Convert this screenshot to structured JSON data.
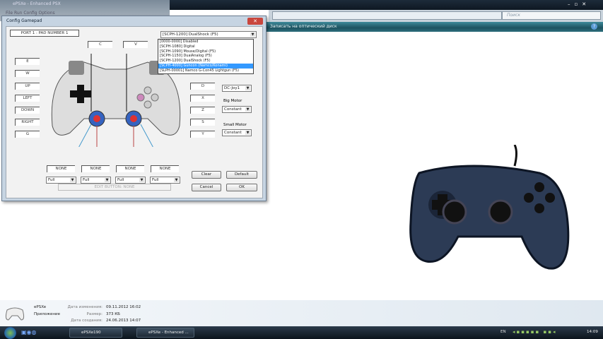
{
  "behind_window": {
    "title": "ePSXe - Enhanced PSX",
    "menu": "File  Run  Config  Options"
  },
  "explorer": {
    "search_placeholder": "Поиск",
    "cmd_label": "Записать на оптический диск",
    "help": "?"
  },
  "dialog": {
    "title": "Config Gamepad",
    "close": "✕",
    "port_label": "PORT 1 : PAD NUMBER 1",
    "pad_type_selected": "[SCPH-1200] DualShock (F5)",
    "pad_type_options": [
      "[0000-0000] Disabled",
      "[SCPH-1080] Digital",
      "[SCPH-1090] Mouse/Digital (F5)",
      "[SCPH-1150] DualAnalog (F5)",
      "[SCPH-1200] DualShock (F5)",
      "[SCPH-4000] Guncon (Namco/Konami)",
      "[SLPH-00001] Namco G-Con45 Lightgun (F5)"
    ],
    "pad_type_highlight_index": 5,
    "top_keys": [
      "C",
      "V"
    ],
    "left_keys": [
      "E",
      "W",
      "UP",
      "LEFT",
      "DOWN",
      "RIGHT",
      "G"
    ],
    "right_keys": [
      "D",
      "X",
      "Z",
      "S",
      "Y"
    ],
    "analog_keys": [
      "NONE",
      "NONE",
      "NONE",
      "NONE"
    ],
    "analog_modes": [
      "Full",
      "Full",
      "Full",
      "Full"
    ],
    "small_combo": "DC-Joy1",
    "big_motor_label": "Big Motor",
    "big_motor": "Constant",
    "small_motor_label": "Small Motor",
    "small_motor": "Constant",
    "edit_button": "EDIT BUTTON: NONE",
    "clear": "Clear",
    "default": "Default",
    "cancel": "Cancel",
    "ok": "OK"
  },
  "details": {
    "name": "ePSXe",
    "type": "Приложение",
    "modified_label": "Дата изменения:",
    "modified": "09.11.2012 16:02",
    "size_label": "Размер:",
    "size": "373 КБ",
    "created_label": "Дата создания:",
    "created": "24.06.2013 14:07"
  },
  "taskbar": {
    "tasks": [
      "ePSXe190",
      "ePSXe - Enhanced ..."
    ],
    "lang": "EN",
    "clock": "14:09"
  },
  "colors": {
    "accent": "#3399ff",
    "cmdbar": "#1d5260"
  }
}
